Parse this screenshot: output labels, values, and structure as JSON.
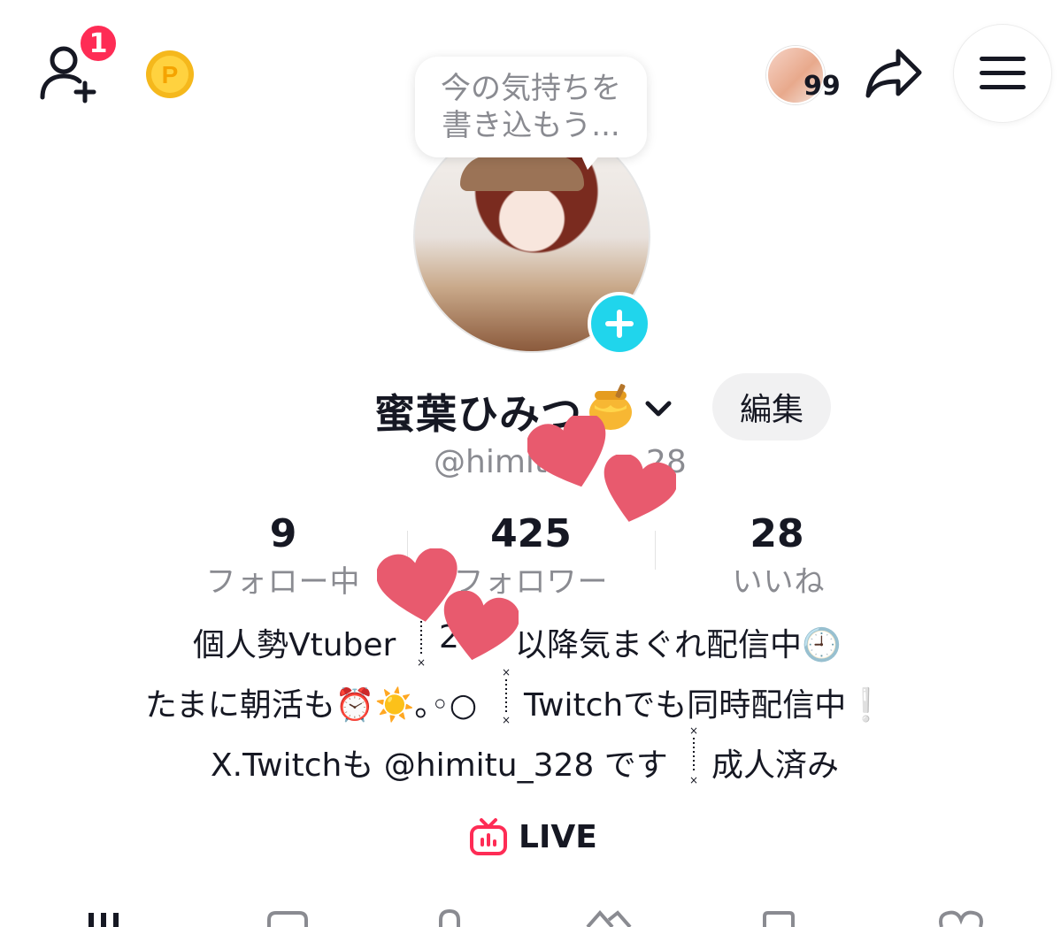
{
  "header": {
    "notification_count": "1",
    "visitor_count": "99",
    "icons": [
      "add-friend-icon",
      "coin-icon",
      "share-icon",
      "menu-icon"
    ],
    "coin_letter": "P"
  },
  "mood_bubble": {
    "placeholder": "今の気持ちを\n書き込もう..."
  },
  "profile": {
    "display_name": "蜜葉ひみつ",
    "handle": "@himit",
    "handle_tail": "28",
    "edit_label": "編集"
  },
  "stats": {
    "following": {
      "value": "9",
      "label": "フォロー中"
    },
    "followers": {
      "value": "425",
      "label": "フォロワー"
    },
    "likes": {
      "value": "28",
      "label": "いいね"
    }
  },
  "bio": {
    "line1_a": "個人勢Vtuber",
    "line1_b": "以降気まぐれ配信中🕘",
    "line1_c": "2",
    "line2_a": "たまに朝活も⏰☀️｡◦○",
    "line2_b": "Twitchでも同時配信中❕",
    "line3_a": "X.Twitchも @himitu_328 です",
    "line3_b": "成人済み"
  },
  "live": {
    "label": "LIVE"
  },
  "colors": {
    "accent_red": "#fe2c55",
    "accent_cyan": "#20d5ec",
    "text_primary": "#161823",
    "text_secondary": "#8a8b91",
    "heart": "#e85a6e"
  }
}
